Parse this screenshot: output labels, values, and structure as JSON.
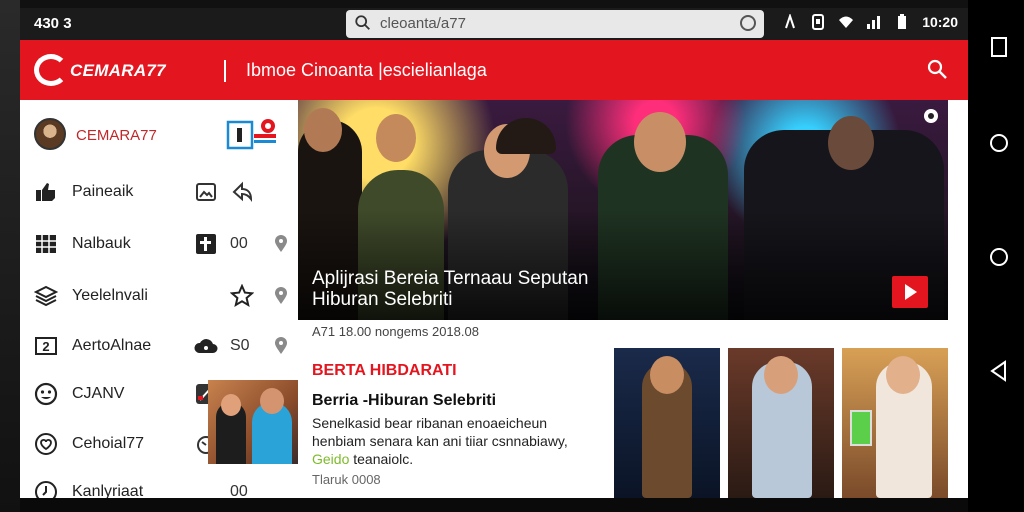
{
  "status_bar": {
    "time_left": "430 3",
    "url": "cleoanta/a77",
    "time_right": "10:20"
  },
  "header": {
    "logo_text": "CEMARA77",
    "title": "Ibmoe Cinoanta |escielianlaga"
  },
  "sidebar": {
    "profile_name": "CEMARA77",
    "items": [
      {
        "label": "Paineaik",
        "icon": "thumbs-up-icon",
        "extra_icon": "gallery-icon",
        "count": ""
      },
      {
        "label": "Nalbauk",
        "icon": "grid-icon",
        "extra_icon": "calendar-icon",
        "count": "00"
      },
      {
        "label": "Yeelelnvali",
        "icon": "layers-icon",
        "extra_icon": "star-icon",
        "count": ""
      },
      {
        "label": "AertoAlnae",
        "icon": "number-icon",
        "extra_icon": "cloud-icon",
        "count": "S0"
      },
      {
        "label": "CJANV",
        "icon": "face-icon",
        "extra_icon": "",
        "count": ""
      },
      {
        "label": "Cehoial77",
        "icon": "heart-chat-icon",
        "extra_icon": "timer-icon",
        "count": ""
      },
      {
        "label": "Kanlyriaat",
        "icon": "clock-icon",
        "extra_icon": "",
        "count": "00"
      }
    ]
  },
  "hero": {
    "title": "Aplijrasi Bereia Ternaau Seputan Hiburan Selebriti",
    "meta": "A71 18.00 nongems 2018.08"
  },
  "article": {
    "section": "BERTA HIBDARATI",
    "title": "Berria -Hiburan Selebriti",
    "body_1": "Senelkasid bear ribanan enoaeicheun",
    "body_2": "henbiam senara kan ani tiiar csnnabiawy,",
    "body_3_highlight": "Geido",
    "body_3": "teanaiolc.",
    "date": "Tlaruk 0008"
  },
  "colors": {
    "accent": "#e3151f",
    "sidebar_text": "#222222",
    "highlight": "#7dbb2a"
  }
}
